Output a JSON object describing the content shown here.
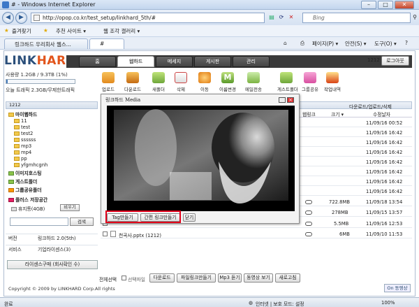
{
  "browser": {
    "window_title": "# - Windows Internet Explorer",
    "address": "http://opop.co.kr/test_setup/linkhard_5th/#",
    "search_placeholder": "Bing",
    "favorites_label": "즐겨찾기",
    "fav_links": [
      "추천 사이트 ▾",
      "웹 조각 갤러리 ▾"
    ],
    "tabs": [
      "링크하드 우리회사 웹스...",
      "#"
    ],
    "menu": [
      "페이지(P) ▾",
      "안전(S) ▾",
      "도구(O) ▾"
    ],
    "status_zone": "인터넷 | 보호 모드: 설정",
    "status_left": "완료",
    "zoom": "100%"
  },
  "app": {
    "logo_link": "LINK",
    "logo_hard": "HARD",
    "nav_tabs": [
      "홈",
      "웹하드",
      "메세지",
      "게시판",
      "관리"
    ],
    "user_no": "1212",
    "logout": "로그아웃"
  },
  "usage": {
    "line1": "사용량 1.2GB / 9.3TB (1%)",
    "fraction": 0.01,
    "line2": "오늘 트래픽 2.3GB/무제한트래픽"
  },
  "toolbar": [
    "업로드",
    "다운로드",
    "새폴더",
    "삭제",
    "이동",
    "이름변경",
    "메일전송",
    "게스트폴더",
    "그룹공유",
    "작업내역"
  ],
  "sidebar": {
    "header": "1212",
    "root": "마이웹하드",
    "folders": [
      "11",
      "test",
      "test2",
      "ssssss",
      "mp3",
      "mp4",
      "pp",
      "yfgmhcgnh"
    ],
    "sections": [
      "이미지호스팅",
      "게스트폴더",
      "그룹공유폴더",
      "플러스 저장공간"
    ],
    "trash": "휴지통(4GB)",
    "trash_btn": "비우기",
    "search_btn": "검색",
    "version_label": "버전",
    "version_value": "링크하드 2.0(5th)",
    "service_label": "서비스",
    "service_value": "기업라이센스(3)",
    "license": "라이센스구매 (회사확인 수)"
  },
  "list": {
    "breadcrumb": "다운로드/업로드/삭제",
    "col_link": "웹링크",
    "col_size": "크기 ▾",
    "col_date": "수정날자",
    "dates": [
      "11/09/16 00:52",
      "11/09/16 16:42",
      "11/09/16 16:42",
      "11/09/16 16:42",
      "11/09/16 16:42",
      "11/09/16 16:42",
      "11/09/16 16:42",
      "11/09/16 16:42",
      "11/09/16 16:42"
    ],
    "sizes": [
      "722.8MB",
      "278MB",
      "5.5MB",
      "6MB"
    ],
    "size_dates": [
      "11/09/18 13:54",
      "11/09/15 13:57",
      "11/09/16 12:53",
      "11/09/10 11:53"
    ],
    "last_file": "천곡사.pptx (1212)",
    "bottom_label": "전체선택",
    "bottom_check": "선택파일",
    "bottom_buttons": [
      "다운로드",
      "파일링크만들기",
      "Mp3 듣기",
      "동영상 보기",
      "새로고침"
    ]
  },
  "popup": {
    "title": "링크하드 Media",
    "buttons": [
      "Tag만들기",
      "간편 링크만들기",
      "닫기"
    ]
  },
  "footer": {
    "copyright": "Copyright © 2009 by LINKHARD Corp.All rights",
    "home_btn": "On 동영상"
  }
}
